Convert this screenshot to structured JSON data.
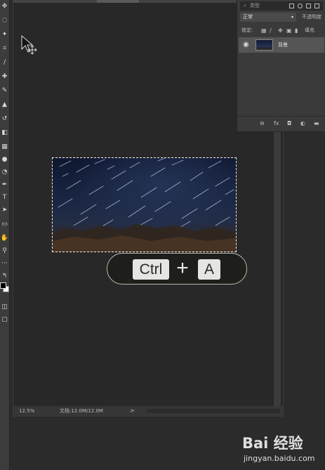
{
  "canvas": {
    "zoom_percent": "12.5%",
    "doc_info": "文档:12.0M/12.0M",
    "status_chevron": ">"
  },
  "shortcut": {
    "key1": "Ctrl",
    "plus": "+",
    "key2": "A"
  },
  "layers_panel": {
    "search_label": "类型",
    "search_icon": "⌕",
    "blend_mode": "正常",
    "blend_arrow": "▾",
    "opacity_label": "不透明度",
    "lock_label": "锁定:",
    "fill_label": "填充",
    "layers": [
      {
        "name": "背景",
        "visible": true
      }
    ],
    "footer_icons": [
      "link-icon",
      "fx-icon",
      "mask-icon",
      "adjustment-icon",
      "folder-icon"
    ],
    "footer_glyphs": {
      "link": "⊖",
      "fx": "fx",
      "mask": "◘",
      "adjustment": "◐",
      "folder": "▬"
    }
  },
  "tools": [
    {
      "name": "move-tool-icon",
      "glyph": "✥"
    },
    {
      "name": "lasso-tool-icon",
      "glyph": "◌"
    },
    {
      "name": "magic-wand-icon",
      "glyph": "✦"
    },
    {
      "name": "crop-tool-icon",
      "glyph": "⌗"
    },
    {
      "name": "eyedropper-icon",
      "glyph": "∕"
    },
    {
      "name": "healing-brush-icon",
      "glyph": "✚"
    },
    {
      "name": "brush-tool-icon",
      "glyph": "✎"
    },
    {
      "name": "stamp-tool-icon",
      "glyph": "▲"
    },
    {
      "name": "history-brush-icon",
      "glyph": "↺"
    },
    {
      "name": "eraser-tool-icon",
      "glyph": "◧"
    },
    {
      "name": "gradient-tool-icon",
      "glyph": "▦"
    },
    {
      "name": "blur-tool-icon",
      "glyph": "●"
    },
    {
      "name": "dodge-tool-icon",
      "glyph": "◔"
    },
    {
      "name": "pen-tool-icon",
      "glyph": "✒"
    },
    {
      "name": "type-tool-icon",
      "glyph": "T"
    },
    {
      "name": "path-select-icon",
      "glyph": "➤"
    },
    {
      "name": "shape-tool-icon",
      "glyph": "▭"
    },
    {
      "name": "hand-tool-icon",
      "glyph": "✋"
    },
    {
      "name": "zoom-tool-icon",
      "glyph": "⚲"
    },
    {
      "name": "more-tools-icon",
      "glyph": "···"
    },
    {
      "name": "swap-colors-icon",
      "glyph": "↰"
    }
  ],
  "bottom_tools": [
    {
      "name": "quick-mask-icon",
      "glyph": "◫"
    },
    {
      "name": "screen-mode-icon",
      "glyph": "▢"
    }
  ],
  "watermark": {
    "brand": "Bai 经验",
    "url": "jingyan.baidu.com"
  },
  "colors": {
    "foreground": "#000000",
    "background": "#ffffff",
    "ui_dark": "#2b2b2b",
    "panel": "#3a3a3a"
  }
}
